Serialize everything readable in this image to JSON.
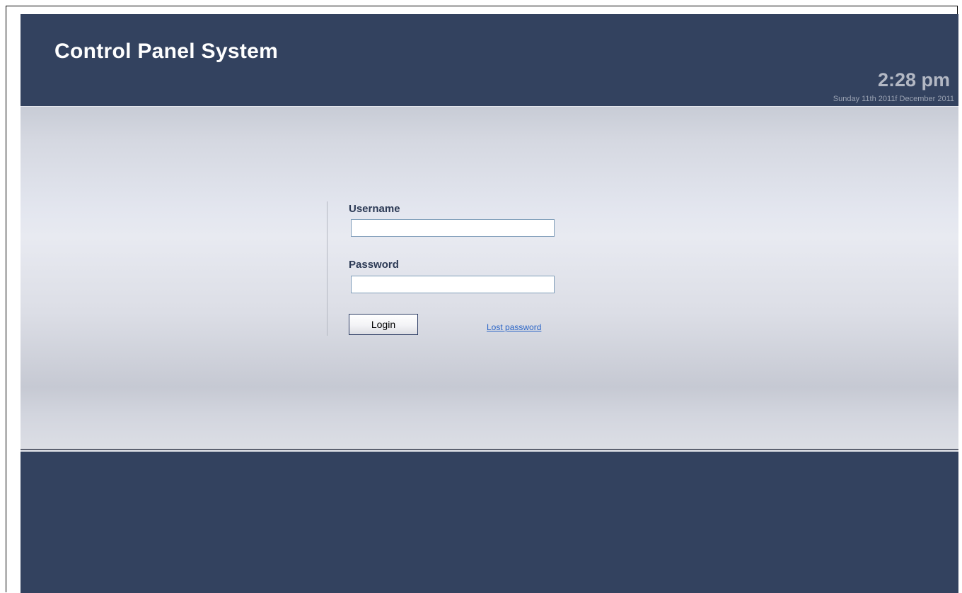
{
  "header": {
    "title": "Control Panel System",
    "time": "2:28 pm",
    "date": "Sunday 11th 2011f December 2011"
  },
  "login_form": {
    "username_label": "Username",
    "username_value": "",
    "password_label": "Password",
    "password_value": "",
    "login_button_label": "Login",
    "lost_password_link": "Lost password"
  },
  "colors": {
    "header_background": "#33425f",
    "footer_background": "#33425f",
    "label_text": "#2c3a55",
    "link": "#2a64c6",
    "clock_text": "#b3b8c4"
  }
}
